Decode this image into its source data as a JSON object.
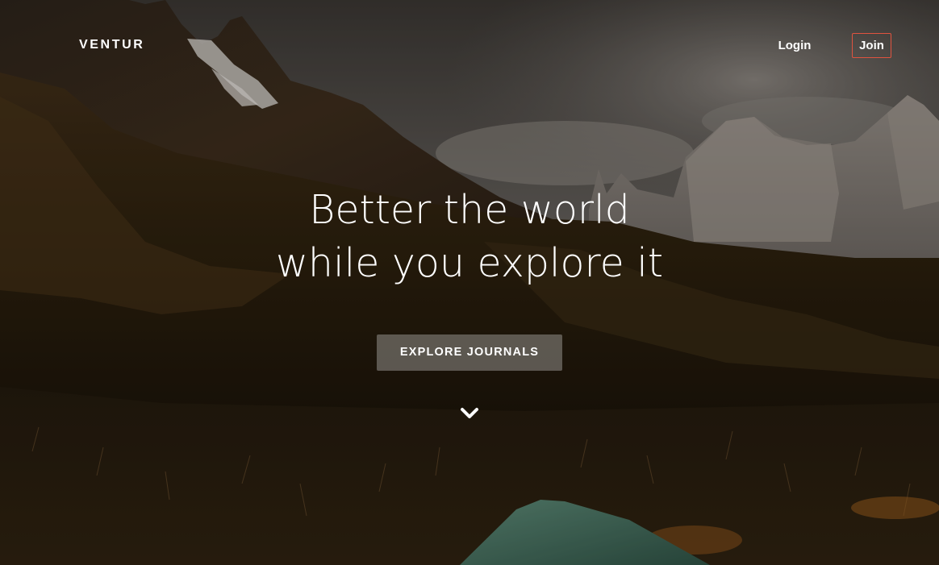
{
  "header": {
    "logo": "VENTUR",
    "login_label": "Login",
    "join_label": "Join"
  },
  "hero": {
    "headline_line1": "Better the world",
    "headline_line2": "while you explore it",
    "cta_label": "EXPLORE JOURNALS",
    "scroll_icon": "chevron-down-icon"
  },
  "colors": {
    "join_border": "#e0533f",
    "text": "#ffffff",
    "cta_bg": "rgba(215,215,215,0.35)"
  }
}
